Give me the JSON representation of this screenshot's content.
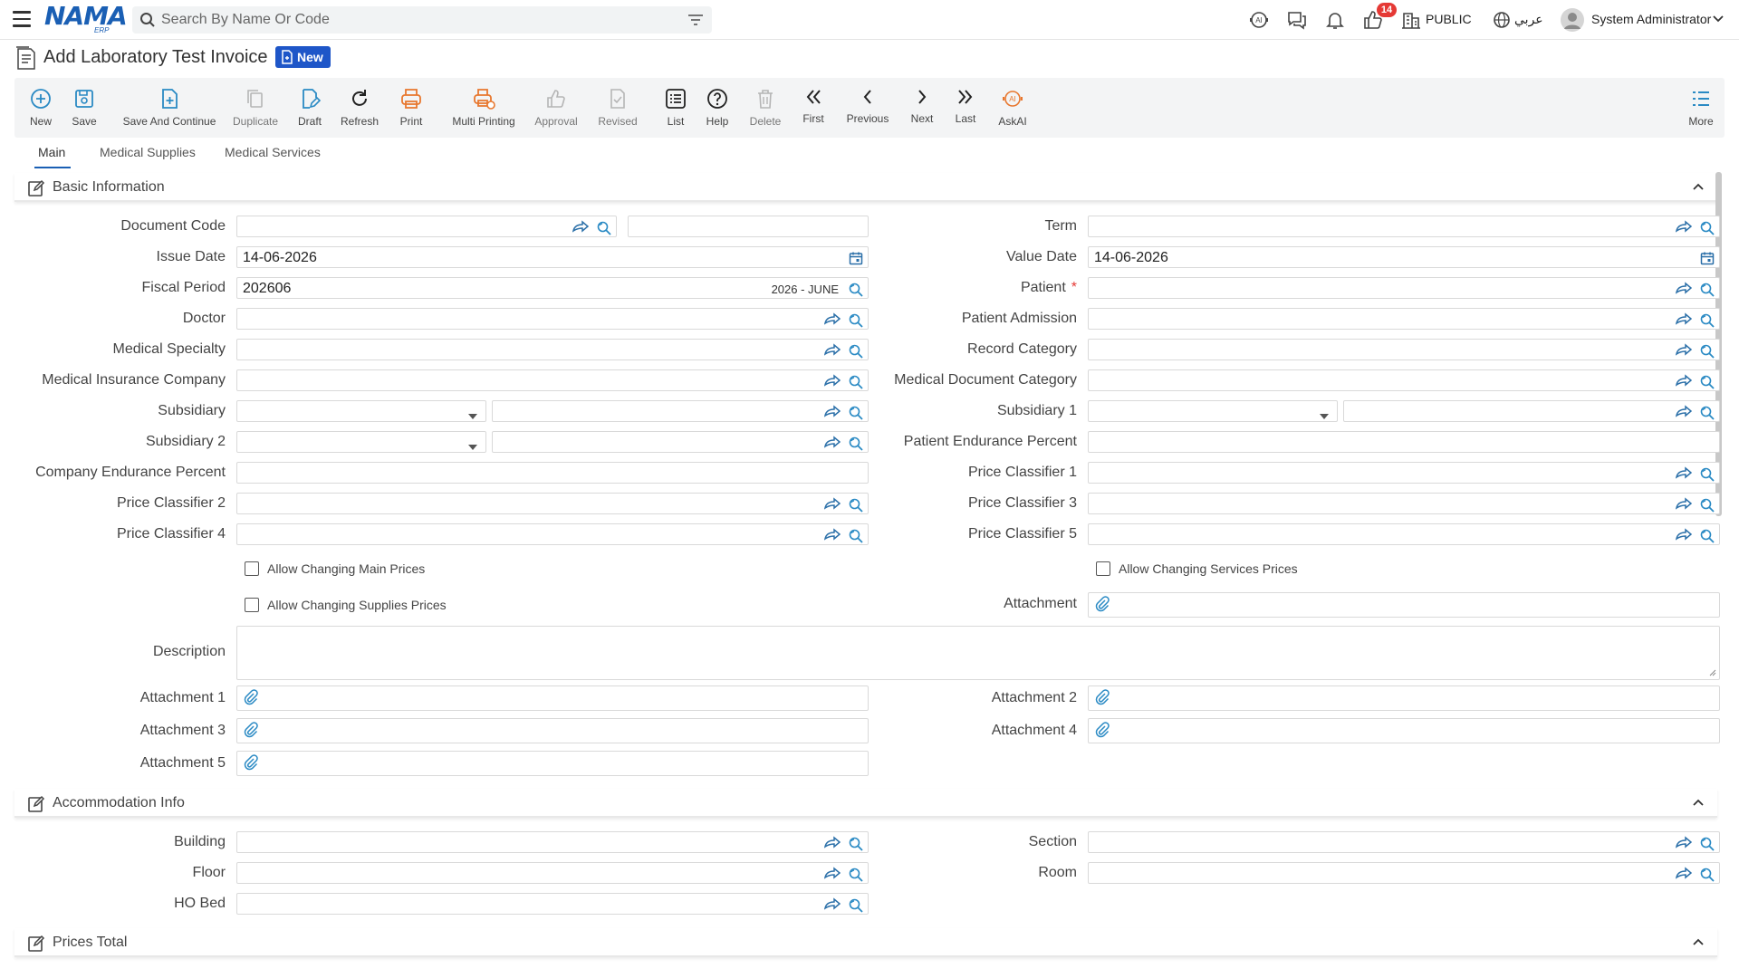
{
  "topbar": {
    "logo": "NAMA",
    "logo_sub": "ERP",
    "search_placeholder": "Search By Name Or Code",
    "notification_count": "14",
    "public_label": "PUBLIC",
    "language_label": "عربي",
    "user_name": "System Administrator"
  },
  "page": {
    "title": "Add Laboratory Test Invoice",
    "status_badge": "New"
  },
  "toolbar": {
    "new": "New",
    "save": "Save",
    "save_continue": "Save And Continue",
    "duplicate": "Duplicate",
    "draft": "Draft",
    "refresh": "Refresh",
    "print": "Print",
    "multi_printing": "Multi Printing",
    "approval": "Approval",
    "revised": "Revised",
    "list": "List",
    "help": "Help",
    "delete": "Delete",
    "first": "First",
    "previous": "Previous",
    "next": "Next",
    "last": "Last",
    "askai": "AskAI",
    "more": "More"
  },
  "tabs": {
    "main": "Main",
    "medical_supplies": "Medical Supplies",
    "medical_services": "Medical Services"
  },
  "sections": {
    "basic": "Basic Information",
    "accommodation": "Accommodation Info",
    "prices": "Prices Total"
  },
  "basic": {
    "document_code": "Document Code",
    "term": "Term",
    "issue_date": "Issue Date",
    "issue_date_value": "14-06-2026",
    "value_date": "Value Date",
    "value_date_value": "14-06-2026",
    "fiscal_period": "Fiscal Period",
    "fiscal_period_value": "202606",
    "fiscal_period_desc": "2026 - JUNE",
    "patient": "Patient",
    "patient_required": "*",
    "doctor": "Doctor",
    "patient_admission": "Patient Admission",
    "medical_specialty": "Medical Specialty",
    "record_category": "Record Category",
    "medical_insurance_company": "Medical Insurance Company",
    "medical_document_category": "Medical Document Category",
    "subsidiary": "Subsidiary",
    "subsidiary_1": "Subsidiary 1",
    "subsidiary_2": "Subsidiary 2",
    "patient_endurance_percent": "Patient Endurance Percent",
    "company_endurance_percent": "Company Endurance Percent",
    "price_classifier_1": "Price Classifier 1",
    "price_classifier_2": "Price Classifier 2",
    "price_classifier_3": "Price Classifier 3",
    "price_classifier_4": "Price Classifier 4",
    "price_classifier_5": "Price Classifier 5",
    "allow_main_prices": "Allow Changing Main Prices",
    "allow_services_prices": "Allow Changing Services Prices",
    "allow_supplies_prices": "Allow Changing Supplies Prices",
    "attachment": "Attachment",
    "description": "Description",
    "attachment_1": "Attachment 1",
    "attachment_2": "Attachment 2",
    "attachment_3": "Attachment 3",
    "attachment_4": "Attachment 4",
    "attachment_5": "Attachment 5"
  },
  "accommodation": {
    "building": "Building",
    "section": "Section",
    "floor": "Floor",
    "room": "Room",
    "ho_bed": "HO Bed"
  },
  "colors": {
    "brand": "#1a5fb4",
    "icon_blue": "#2a8ac4",
    "icon_orange": "#e8772e",
    "badge_red": "#e53935"
  }
}
